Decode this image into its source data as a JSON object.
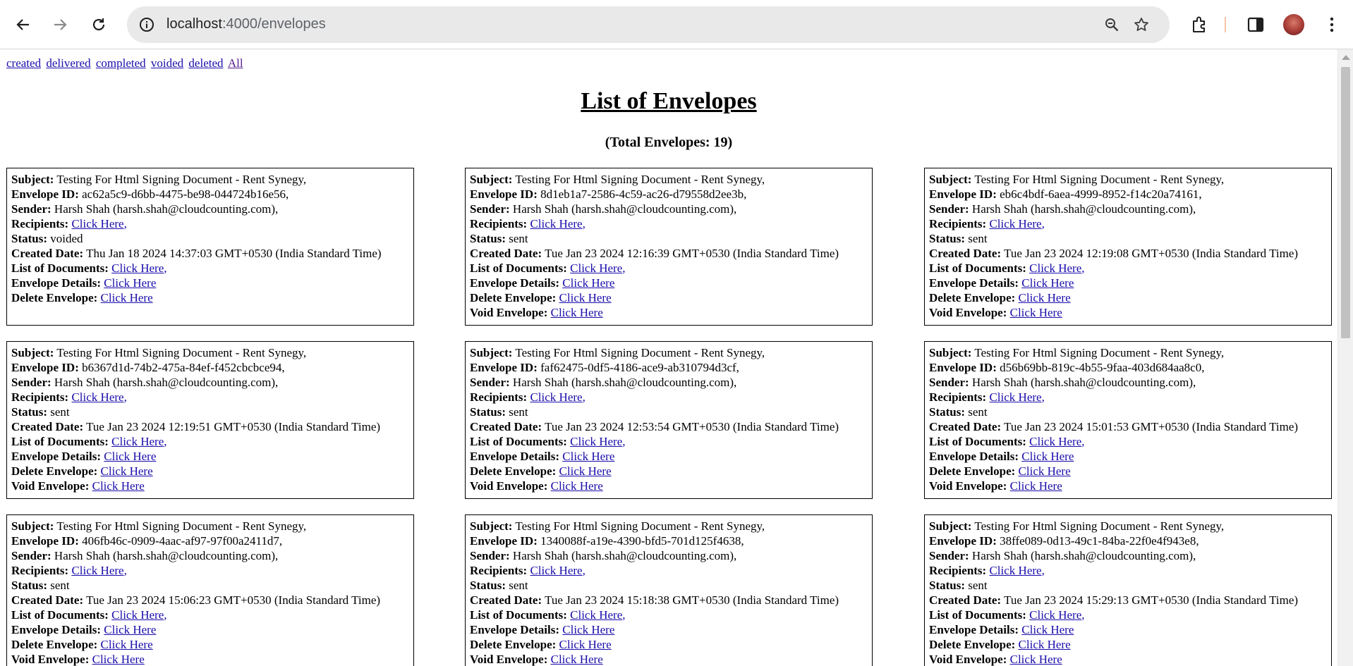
{
  "browser": {
    "url_host": "localhost",
    "url_rest": ":4000/envelopes"
  },
  "filters": [
    {
      "label": "created"
    },
    {
      "label": "delivered"
    },
    {
      "label": "completed"
    },
    {
      "label": "voided"
    },
    {
      "label": "deleted"
    },
    {
      "label": "All"
    }
  ],
  "page": {
    "title": "List of Envelopes",
    "total": "(Total Envelopes: 19)"
  },
  "labels": {
    "subject": "Subject:",
    "envelope_id": "Envelope ID:",
    "sender": "Sender:",
    "recipients": "Recipients:",
    "status": "Status:",
    "created_date": "Created Date:",
    "documents": "List of Documents:",
    "details": "Envelope Details:",
    "delete": "Delete Envelope:",
    "void": "Void Envelope:",
    "link": "Click Here"
  },
  "envelopes": [
    {
      "subject": "Testing For Html Signing Document - Rent Synegy,",
      "id": "ac62a5c9-d6bb-4475-be98-044724b16e56,",
      "sender": "Harsh Shah (harsh.shah@cloudcounting.com),",
      "status": "voided",
      "created": "Thu Jan 18 2024 14:37:03 GMT+0530 (India Standard Time)",
      "void": false
    },
    {
      "subject": "Testing For Html Signing Document - Rent Synegy,",
      "id": "8d1eb1a7-2586-4c59-ac26-d79558d2ee3b,",
      "sender": "Harsh Shah (harsh.shah@cloudcounting.com),",
      "status": "sent",
      "created": "Tue Jan 23 2024 12:16:39 GMT+0530 (India Standard Time)",
      "void": true
    },
    {
      "subject": "Testing For Html Signing Document - Rent Synegy,",
      "id": "eb6c4bdf-6aea-4999-8952-f14c20a74161,",
      "sender": "Harsh Shah (harsh.shah@cloudcounting.com),",
      "status": "sent",
      "created": "Tue Jan 23 2024 12:19:08 GMT+0530 (India Standard Time)",
      "void": true
    },
    {
      "subject": "Testing For Html Signing Document - Rent Synegy,",
      "id": "b6367d1d-74b2-475a-84ef-f452cbcbce94,",
      "sender": "Harsh Shah (harsh.shah@cloudcounting.com),",
      "status": "sent",
      "created": "Tue Jan 23 2024 12:19:51 GMT+0530 (India Standard Time)",
      "void": true
    },
    {
      "subject": "Testing For Html Signing Document - Rent Synegy,",
      "id": "faf62475-0df5-4186-ace9-ab310794d3cf,",
      "sender": "Harsh Shah (harsh.shah@cloudcounting.com),",
      "status": "sent",
      "created": "Tue Jan 23 2024 12:53:54 GMT+0530 (India Standard Time)",
      "void": true
    },
    {
      "subject": "Testing For Html Signing Document - Rent Synegy,",
      "id": "d56b69bb-819c-4b55-9faa-403d684aa8c0,",
      "sender": "Harsh Shah (harsh.shah@cloudcounting.com),",
      "status": "sent",
      "created": "Tue Jan 23 2024 15:01:53 GMT+0530 (India Standard Time)",
      "void": true
    },
    {
      "subject": "Testing For Html Signing Document - Rent Synegy,",
      "id": "406fb46c-0909-4aac-af97-97f00a2411d7,",
      "sender": "Harsh Shah (harsh.shah@cloudcounting.com),",
      "status": "sent",
      "created": "Tue Jan 23 2024 15:06:23 GMT+0530 (India Standard Time)",
      "void": true
    },
    {
      "subject": "Testing For Html Signing Document - Rent Synegy,",
      "id": "1340088f-a19e-4390-bfd5-701d125f4638,",
      "sender": "Harsh Shah (harsh.shah@cloudcounting.com),",
      "status": "sent",
      "created": "Tue Jan 23 2024 15:18:38 GMT+0530 (India Standard Time)",
      "void": true
    },
    {
      "subject": "Testing For Html Signing Document - Rent Synegy,",
      "id": "38ffe089-0d13-49c1-84ba-22f0e4f943e8,",
      "sender": "Harsh Shah (harsh.shah@cloudcounting.com),",
      "status": "sent",
      "created": "Tue Jan 23 2024 15:29:13 GMT+0530 (India Standard Time)",
      "void": true
    }
  ]
}
